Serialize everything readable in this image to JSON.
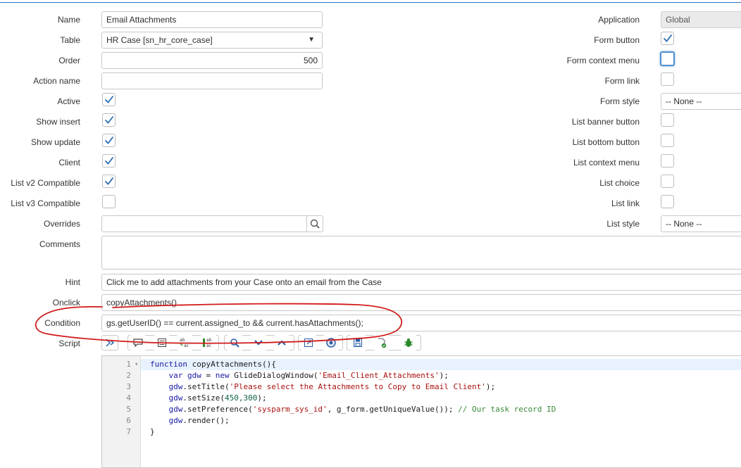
{
  "left_fields": {
    "name": {
      "label": "Name",
      "value": "Email Attachments"
    },
    "table": {
      "label": "Table",
      "value": "HR Case [sn_hr_core_case]"
    },
    "order": {
      "label": "Order",
      "value": "500"
    },
    "action_name": {
      "label": "Action name",
      "value": ""
    },
    "active": {
      "label": "Active",
      "checked": true
    },
    "show_insert": {
      "label": "Show insert",
      "checked": true
    },
    "show_update": {
      "label": "Show update",
      "checked": true
    },
    "client": {
      "label": "Client",
      "checked": true
    },
    "list_v2": {
      "label": "List v2 Compatible",
      "checked": true
    },
    "list_v3": {
      "label": "List v3 Compatible",
      "checked": false
    },
    "overrides": {
      "label": "Overrides",
      "value": ""
    },
    "comments": {
      "label": "Comments",
      "value": ""
    },
    "hint": {
      "label": "Hint",
      "value": "Click me to add attachments from your Case onto an email from the Case"
    },
    "onclick": {
      "label": "Onclick",
      "value": "copyAttachments()"
    },
    "condition": {
      "label": "Condition",
      "value": "gs.getUserID() == current.assigned_to && current.hasAttachments();"
    },
    "script": {
      "label": "Script"
    }
  },
  "right_fields": {
    "application": {
      "label": "Application",
      "value": "Global"
    },
    "form_button": {
      "label": "Form button",
      "checked": true
    },
    "form_context_menu": {
      "label": "Form context menu",
      "checked": false
    },
    "form_link": {
      "label": "Form link",
      "checked": false
    },
    "form_style": {
      "label": "Form style",
      "value": "-- None --"
    },
    "list_banner_button": {
      "label": "List banner button",
      "checked": false
    },
    "list_bottom_button": {
      "label": "List bottom button",
      "checked": false
    },
    "list_context_menu": {
      "label": "List context menu",
      "checked": false
    },
    "list_choice": {
      "label": "List choice",
      "checked": false
    },
    "list_link": {
      "label": "List link",
      "checked": false
    },
    "list_style": {
      "label": "List style",
      "value": "-- None --"
    }
  },
  "icons": {
    "table_dropdown": "▼",
    "overrides_search": "search-icon"
  },
  "editor": {
    "line_numbers": [
      "1",
      "2",
      "3",
      "4",
      "5",
      "6",
      "7"
    ],
    "fold_marker": "▾",
    "lines": [
      {
        "p1": "function",
        "p2": " copyAttachments(){"
      },
      {
        "indent": "    ",
        "kw": "var",
        "var": " gdw",
        "mid": " = ",
        "kw2": "new",
        "rest": " GlideDialogWindow(",
        "str": "'Email_Client_Attachments'",
        "end": ");"
      },
      {
        "indent": "    ",
        "var": "gdw",
        "rest": ".setTitle(",
        "str": "'Please select the Attachments to Copy to Email Client'",
        "end": ");"
      },
      {
        "indent": "    ",
        "var": "gdw",
        "rest": ".setSize(",
        "num": "450,300",
        "end": ");"
      },
      {
        "indent": "    ",
        "var": "gdw",
        "rest": ".setPreference(",
        "str": "'sysparm_sys_id'",
        "end": ", g_form.getUniqueValue()); ",
        "cmt": "// Our task record ID"
      },
      {
        "indent": "    ",
        "var": "gdw",
        "rest": ".render();"
      },
      {
        "rest": "}"
      }
    ]
  },
  "colors": {
    "annotation": "#d11a1a",
    "focus": "#4f8fd0",
    "check": "#2b6cb0"
  }
}
